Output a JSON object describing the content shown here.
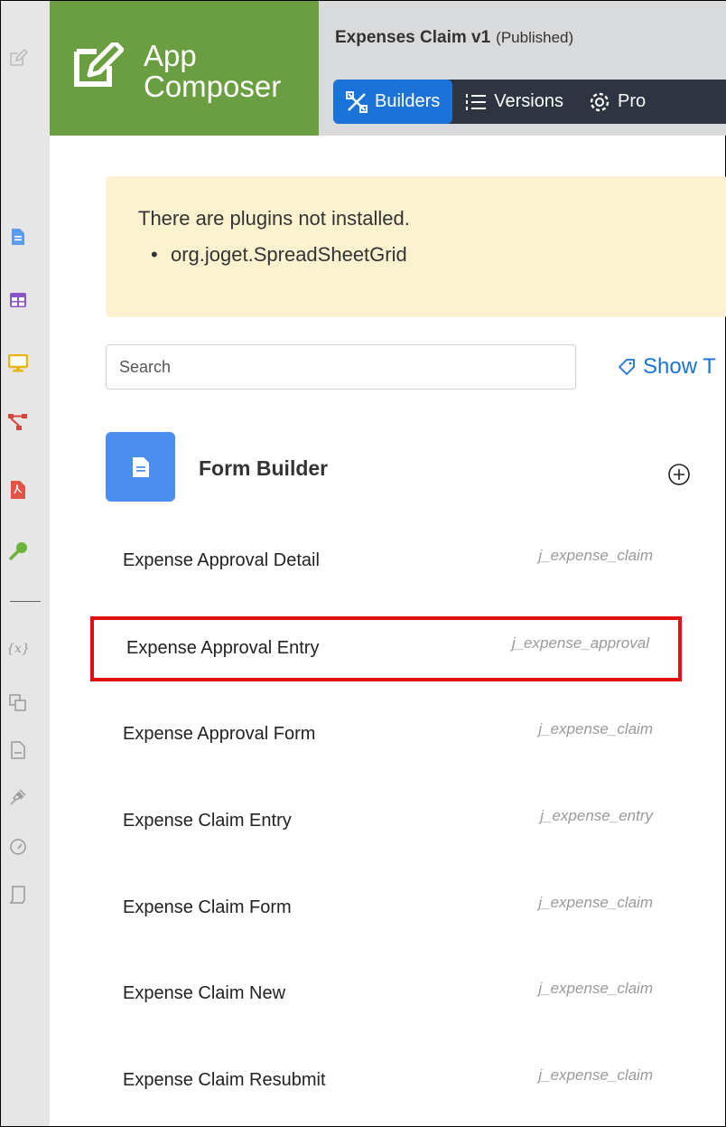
{
  "header": {
    "brand_line1": "App",
    "brand_line2": "Composer",
    "app_name": "Expenses Claim v1",
    "app_status": "(Published)",
    "tabs": [
      {
        "label": "Builders",
        "active": true,
        "icon": "builders-icon"
      },
      {
        "label": "Versions",
        "active": false,
        "icon": "versions-icon"
      },
      {
        "label": "Pro",
        "active": false,
        "icon": "gear-icon"
      }
    ]
  },
  "sidebar": {
    "icons": [
      "edit-icon",
      "form-icon",
      "datalist-icon",
      "userview-icon",
      "process-icon",
      "pdf-icon",
      "key-icon",
      "variable-icon",
      "resources-icon",
      "document-icon",
      "plugin-icon",
      "performance-icon",
      "logs-icon"
    ],
    "variable_glyph": "{x}"
  },
  "alert": {
    "title": "There are plugins not installed.",
    "items": [
      "org.joget.SpreadSheetGrid"
    ]
  },
  "search": {
    "placeholder": "Search",
    "value": ""
  },
  "show_tags_label": "Show T",
  "builder": {
    "title": "Form Builder",
    "rows": [
      {
        "label": "Expense Approval Detail",
        "table": "j_expense_claim",
        "highlighted": false
      },
      {
        "label": "Expense Approval Entry",
        "table": "j_expense_approval",
        "highlighted": true
      },
      {
        "label": "Expense Approval Form",
        "table": "j_expense_claim",
        "highlighted": false
      },
      {
        "label": "Expense Claim Entry",
        "table": "j_expense_entry",
        "highlighted": false
      },
      {
        "label": "Expense Claim Form",
        "table": "j_expense_claim",
        "highlighted": false
      },
      {
        "label": "Expense Claim New",
        "table": "j_expense_claim",
        "highlighted": false
      },
      {
        "label": "Expense Claim Resubmit",
        "table": "j_expense_claim",
        "highlighted": false
      }
    ]
  },
  "colors": {
    "brand_green": "#6b9e40",
    "tab_active_blue": "#1a73d9",
    "tab_bar_dark": "#2f3540",
    "alert_bg": "#fdf2d0",
    "highlight_red": "#e01010"
  }
}
